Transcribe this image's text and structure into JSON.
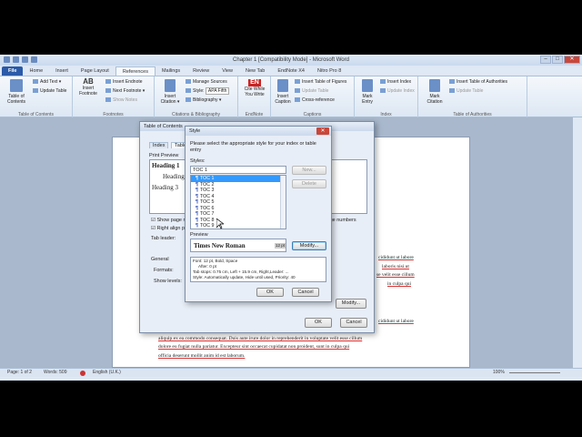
{
  "window": {
    "title": "Chapter 1 [Compatibility Mode] - Microsoft Word",
    "min": "–",
    "max": "□",
    "close": "✕"
  },
  "tabs": [
    {
      "label": "File"
    },
    {
      "label": "Home"
    },
    {
      "label": "Insert"
    },
    {
      "label": "Page Layout"
    },
    {
      "label": "References"
    },
    {
      "label": "Mailings"
    },
    {
      "label": "Review"
    },
    {
      "label": "View"
    },
    {
      "label": "New Tab"
    },
    {
      "label": "EndNote X4"
    },
    {
      "label": "Nitro Pro 8"
    }
  ],
  "ribbon": {
    "toc": {
      "big": "Table of Contents",
      "add_text": "Add Text ▾",
      "update": "Update Table",
      "group": "Table of Contents"
    },
    "footnotes": {
      "insert_endnote": "Insert Endnote",
      "next_footnote": "Next Footnote ▾",
      "show_notes": "Show Notes",
      "big_icon": "AB",
      "big": "Insert Footnote",
      "group": "Footnotes"
    },
    "citations": {
      "insert_citation": "Insert Citation ▾",
      "manage": "Manage Sources",
      "style_label": "Style:",
      "style_value": "APA Fifth",
      "bibliography": "Bibliography ▾",
      "group": "Citations & Bibliography"
    },
    "endnote": {
      "cite": "Cite While You Write",
      "icon": "EN",
      "group": "EndNote"
    },
    "captions": {
      "insert_caption": "Insert Caption",
      "insert_tof": "Insert Table of Figures",
      "update_table": "Update Table",
      "cross_ref": "Cross-reference",
      "group": "Captions"
    },
    "index": {
      "mark_entry": "Mark Entry",
      "insert_index": "Insert Index",
      "update_index": "Update Index",
      "group": "Index"
    },
    "toa": {
      "mark_citation": "Mark Citation",
      "insert_toa": "Insert Table of Authorities",
      "update_table": "Update Table",
      "group": "Table of Authorities"
    }
  },
  "document": {
    "lines_top": [
      "cididunt ut labore",
      "laboris nisi ut",
      "se velit esse cillum",
      "in culpa qui"
    ],
    "lines_bottom": [
      "cididunt ut labore",
      "aliquip ex ea commodo consequat. Duis aute irure dolor in reprehenderit in voluptate velit esse cillum",
      "dolore eu fugiat nulla pariatur. Excepteur sint occaecat cupidatat non proident, sunt in culpa qui",
      "officia deserunt mollit anim id est laborum."
    ]
  },
  "toc_dialog": {
    "title": "Table of Contents",
    "tabs": [
      "Index",
      "Table"
    ],
    "print_preview_label": "Print Preview",
    "headings": [
      "Heading 1",
      "Heading 2",
      "Heading 3"
    ],
    "show_page_numbers": "Show page n",
    "right_align": "Right align p",
    "tab_leader": "Tab leader:",
    "use_hyperlinks": "page numbers",
    "general": "General",
    "formats": "Formats:",
    "show_levels": "Show levels:",
    "modify": "Modify...",
    "ok": "OK",
    "cancel": "Cancel"
  },
  "style_dialog": {
    "title": "Style",
    "instruction": "Please select the appropriate style for your index or table entry",
    "styles_label": "Styles:",
    "style_input": "TOC 1",
    "new_button": "New...",
    "delete_button": "Delete",
    "styles": [
      "TOC 1",
      "TOC 2",
      "TOC 3",
      "TOC 4",
      "TOC 5",
      "TOC 6",
      "TOC 7",
      "TOC 8",
      "TOC 9"
    ],
    "selected_index": 0,
    "preview_label": "Preview",
    "preview_font": "Times New Roman",
    "preview_size": "12 pt",
    "modify_button": "Modify...",
    "description": [
      "Font: 12 pt, Bold, Space",
      "After: 0 pt",
      "Tab stops: 0.75 cm, Left + 15.9 cm, Right,Leader: ...",
      "Style: Automatically update, Hide until used, Priority: 40"
    ],
    "ok": "OK",
    "cancel": "Cancel"
  },
  "status": {
    "page": "Page: 1 of 2",
    "words": "Words: 509",
    "language": "English (U.K.)",
    "zoom": "100%"
  }
}
